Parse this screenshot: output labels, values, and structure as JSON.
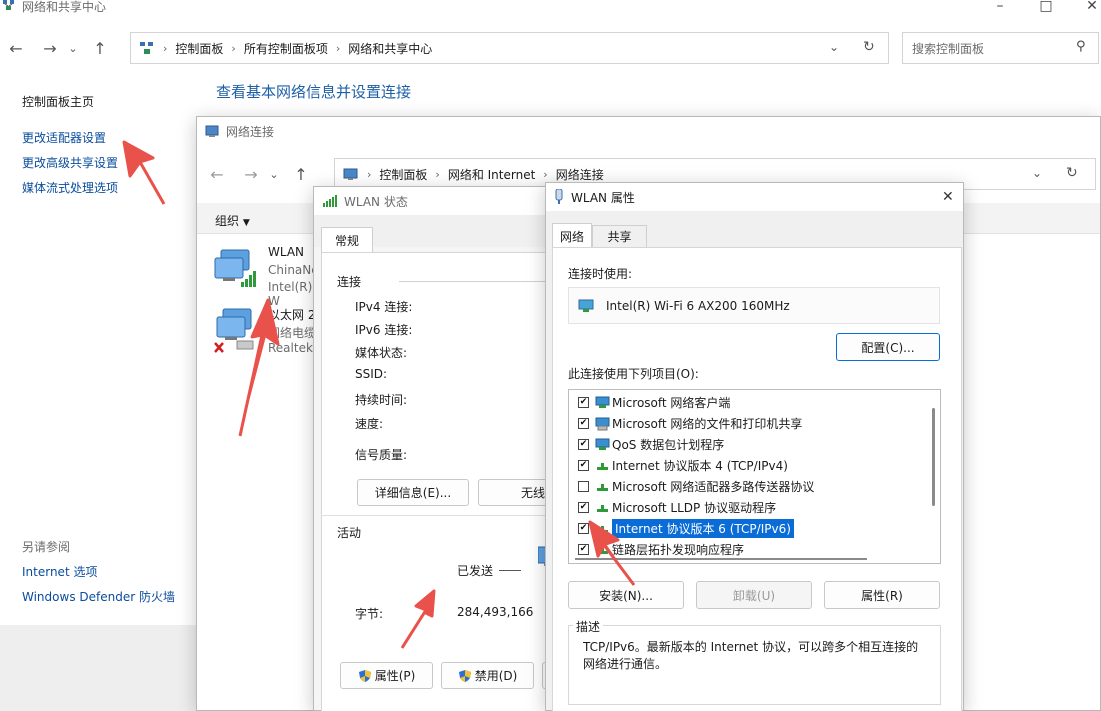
{
  "main": {
    "title": "网络和共享中心",
    "breadcrumb": [
      "控制面板",
      "所有控制面板项",
      "网络和共享中心"
    ],
    "search_placeholder": "搜索控制面板",
    "heading": "查看基本网络信息并设置连接",
    "sidebar": {
      "home": "控制面板主页",
      "links": [
        "更改适配器设置",
        "更改高级共享设置",
        "媒体流式处理选项"
      ],
      "see_also_label": "另请参阅",
      "see_also": [
        "Internet 选项",
        "Windows Defender 防火墙"
      ]
    }
  },
  "netconn": {
    "title": "网络连接",
    "breadcrumb": [
      "控制面板",
      "网络和 Internet",
      "网络连接"
    ],
    "organize": "组织",
    "adapters": [
      {
        "name": "WLAN",
        "line2": "ChinaNe",
        "line3": "Intel(R) W"
      },
      {
        "name": "以太网 2",
        "line2": "网络电缆",
        "line3": "Realtek"
      }
    ]
  },
  "wlan_status": {
    "title": "WLAN 状态",
    "tab": "常规",
    "connection_label": "连接",
    "fields": [
      "IPv4 连接:",
      "IPv6 连接:",
      "媒体状态:",
      "SSID:",
      "持续时间:",
      "速度:"
    ],
    "signal_label": "信号质量:",
    "details_button": "详细信息(E)...",
    "wireless_button": "无线",
    "activity_label": "活动",
    "sent_label": "已发送",
    "bytes_label": "字节:",
    "bytes_sent": "284,493,166",
    "properties_button": "属性(P)",
    "disable_button": "禁用(D)"
  },
  "wlan_props": {
    "title": "WLAN 属性",
    "tabs": [
      "网络",
      "共享"
    ],
    "connect_using_label": "连接时使用:",
    "adapter_name": "Intel(R) Wi-Fi 6 AX200 160MHz",
    "configure_button": "配置(C)...",
    "items_label": "此连接使用下列项目(O):",
    "items": [
      {
        "label": "Microsoft 网络客户端",
        "checked": true,
        "icon": "network-client-icon"
      },
      {
        "label": "Microsoft 网络的文件和打印机共享",
        "checked": true,
        "icon": "file-printer-sharing-icon"
      },
      {
        "label": "QoS 数据包计划程序",
        "checked": true,
        "icon": "qos-icon"
      },
      {
        "label": "Internet 协议版本 4 (TCP/IPv4)",
        "checked": true,
        "icon": "protocol-icon"
      },
      {
        "label": "Microsoft 网络适配器多路传送器协议",
        "checked": false,
        "icon": "protocol-icon"
      },
      {
        "label": "Microsoft LLDP 协议驱动程序",
        "checked": true,
        "icon": "protocol-icon"
      },
      {
        "label": "Internet 协议版本 6 (TCP/IPv6)",
        "checked": true,
        "icon": "protocol-icon",
        "selected": true
      },
      {
        "label": "链路层拓扑发现响应程序",
        "checked": true,
        "icon": "protocol-icon"
      }
    ],
    "install_button": "安装(N)...",
    "uninstall_button": "卸载(U)",
    "properties_button": "属性(R)",
    "description_label": "描述",
    "description_text": "TCP/IPv6。最新版本的 Internet 协议，可以跨多个相互连接的网络进行通信。"
  },
  "colors": {
    "link": "#0a4c9c",
    "heading": "#1e5fa8",
    "selection": "#0a6cd6",
    "arrow": "#e8524a"
  }
}
